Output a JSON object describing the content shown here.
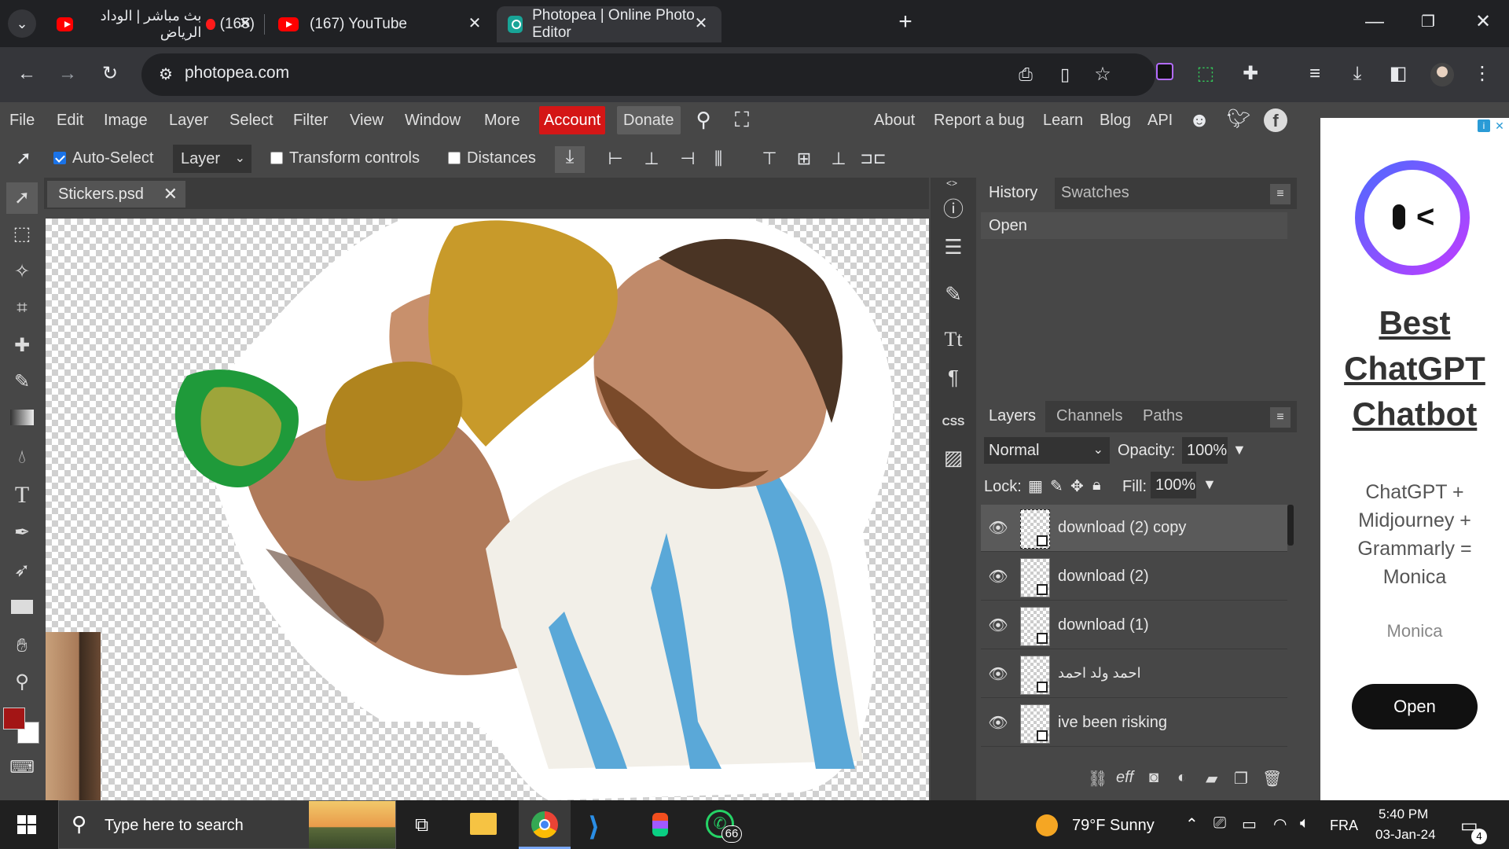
{
  "browser": {
    "tabs": [
      {
        "title": "بث مباشر | الوداد الرياض",
        "badge": "(165)",
        "active": false
      },
      {
        "title": "(167) YouTube",
        "active": false
      },
      {
        "title": "Photopea | Online Photo Editor",
        "active": true
      }
    ],
    "url": "photopea.com"
  },
  "menu": {
    "items": [
      "File",
      "Edit",
      "Image",
      "Layer",
      "Select",
      "Filter",
      "View",
      "Window",
      "More"
    ],
    "account": "Account",
    "donate": "Donate",
    "right_links": [
      "About",
      "Report a bug",
      "Learn",
      "Blog",
      "API"
    ]
  },
  "options": {
    "auto_select": "Auto-Select",
    "target": "Layer",
    "transform_controls": "Transform controls",
    "distances": "Distances"
  },
  "document": {
    "tab_name": "Stickers.psd"
  },
  "history": {
    "tabs": [
      "History",
      "Swatches"
    ],
    "entries": [
      "Open"
    ]
  },
  "layers": {
    "tabs": [
      "Layers",
      "Channels",
      "Paths"
    ],
    "blend_mode": "Normal",
    "opacity_label": "Opacity:",
    "opacity": "100%",
    "lock_label": "Lock:",
    "fill_label": "Fill:",
    "fill": "100%",
    "items": [
      {
        "name": "download (2) copy",
        "selected": true
      },
      {
        "name": "download (2)",
        "selected": false
      },
      {
        "name": "download (1)",
        "selected": false
      },
      {
        "name": "احمد ولد احمد",
        "selected": false
      },
      {
        "name": "ive been risking",
        "selected": false
      }
    ]
  },
  "ad": {
    "headline": "Best ChatGPT Chatbot",
    "body": "ChatGPT + Midjourney + Grammarly = Monica",
    "brand": "Monica",
    "cta": "Open"
  },
  "taskbar": {
    "search_placeholder": "Type here to search",
    "whatsapp_badge": "66",
    "weather": "79°F  Sunny",
    "language": "FRA",
    "time": "5:40 PM",
    "date": "03-Jan-24",
    "notifications": "4"
  },
  "colors": {
    "photopea_bg": "#474747",
    "account_red": "#d41616",
    "foreground_color": "#a31515",
    "background_color": "#ffffff"
  }
}
